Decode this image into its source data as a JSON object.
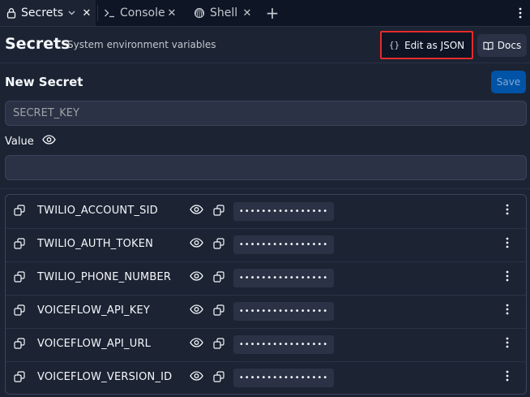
{
  "tabs": [
    {
      "label": "Secrets",
      "icon": "lock-icon",
      "active": true
    },
    {
      "label": "Console",
      "icon": "terminal-icon",
      "active": false
    },
    {
      "label": "Shell",
      "icon": "shell-icon",
      "active": false
    }
  ],
  "header": {
    "title": "Secrets",
    "subtitle": "System environment variables",
    "edit_json_label": "Edit as JSON",
    "edit_json_icon": "{}",
    "docs_label": "Docs"
  },
  "new_secret": {
    "title": "New Secret",
    "save_label": "Save",
    "key_placeholder": "SECRET_KEY",
    "value_label": "Value",
    "value_placeholder": ""
  },
  "secrets": [
    {
      "key": "TWILIO_ACCOUNT_SID",
      "masked_value": "••••••••••••••••"
    },
    {
      "key": "TWILIO_AUTH_TOKEN",
      "masked_value": "••••••••••••••••"
    },
    {
      "key": "TWILIO_PHONE_NUMBER",
      "masked_value": "••••••••••••••••"
    },
    {
      "key": "VOICEFLOW_API_KEY",
      "masked_value": "••••••••••••••••"
    },
    {
      "key": "VOICEFLOW_API_URL",
      "masked_value": "••••••••••••••••"
    },
    {
      "key": "VOICEFLOW_VERSION_ID",
      "masked_value": "••••••••••••••••"
    }
  ],
  "colors": {
    "background": "#1c2333",
    "tabbar": "#0e1525",
    "highlight_border": "#e52b2b",
    "save_button": "#0053a6"
  }
}
